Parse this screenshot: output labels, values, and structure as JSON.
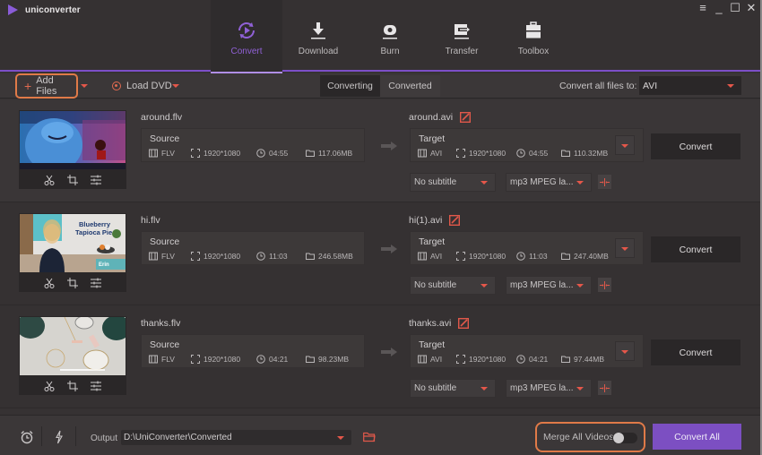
{
  "app": {
    "title": "uniconverter",
    "window_controls": [
      "menu-icon",
      "minimize-icon",
      "maximize-icon",
      "close-icon"
    ]
  },
  "nav": {
    "items": [
      {
        "label": "Convert",
        "icon": "convert-icon",
        "active": true
      },
      {
        "label": "Download",
        "icon": "download-icon",
        "active": false
      },
      {
        "label": "Burn",
        "icon": "burn-icon",
        "active": false
      },
      {
        "label": "Transfer",
        "icon": "transfer-icon",
        "active": false
      },
      {
        "label": "Toolbox",
        "icon": "toolbox-icon",
        "active": false
      }
    ]
  },
  "toolbar": {
    "add_files_label": "Add Files",
    "load_dvd_label": "Load DVD",
    "tabs": [
      {
        "label": "Converting",
        "active": true
      },
      {
        "label": "Converted",
        "active": false
      }
    ],
    "convert_all_to_label": "Convert all files to:",
    "convert_all_to_value": "AVI"
  },
  "files": [
    {
      "source_name": "around.flv",
      "source": {
        "title": "Source",
        "format": "FLV",
        "resolution": "1920*1080",
        "duration": "04:55",
        "size": "117.06MB"
      },
      "target_name": "around.avi",
      "target": {
        "title": "Target",
        "format": "AVI",
        "resolution": "1920*1080",
        "duration": "04:55",
        "size": "110.32MB"
      },
      "convert_label": "Convert",
      "subtitle": "No subtitle",
      "audio": "mp3 MPEG la..."
    },
    {
      "source_name": "hi.flv",
      "source": {
        "title": "Source",
        "format": "FLV",
        "resolution": "1920*1080",
        "duration": "11:03",
        "size": "246.58MB"
      },
      "target_name": "hi(1).avi",
      "target": {
        "title": "Target",
        "format": "AVI",
        "resolution": "1920*1080",
        "duration": "11:03",
        "size": "247.40MB"
      },
      "convert_label": "Convert",
      "subtitle": "No subtitle",
      "audio": "mp3 MPEG la...",
      "thumb_text": {
        "line1": "Blueberry",
        "line2": "Tapioca Pie",
        "name": "Erin"
      }
    },
    {
      "source_name": "thanks.flv",
      "source": {
        "title": "Source",
        "format": "FLV",
        "resolution": "1920*1080",
        "duration": "04:21",
        "size": "98.23MB"
      },
      "target_name": "thanks.avi",
      "target": {
        "title": "Target",
        "format": "AVI",
        "resolution": "1920*1080",
        "duration": "04:21",
        "size": "97.44MB"
      },
      "convert_label": "Convert",
      "subtitle": "No subtitle",
      "audio": "mp3 MPEG la..."
    }
  ],
  "footer": {
    "output_label": "Output",
    "output_path": "D:\\UniConverter\\Converted",
    "merge_label": "Merge All Videos",
    "merge_enabled": false,
    "convert_all_label": "Convert All"
  },
  "colors": {
    "accent_purple": "#7c4fc2",
    "nav_active": "#9061d6",
    "highlight_orange": "#e07a48",
    "caret_red": "#e5574a"
  }
}
